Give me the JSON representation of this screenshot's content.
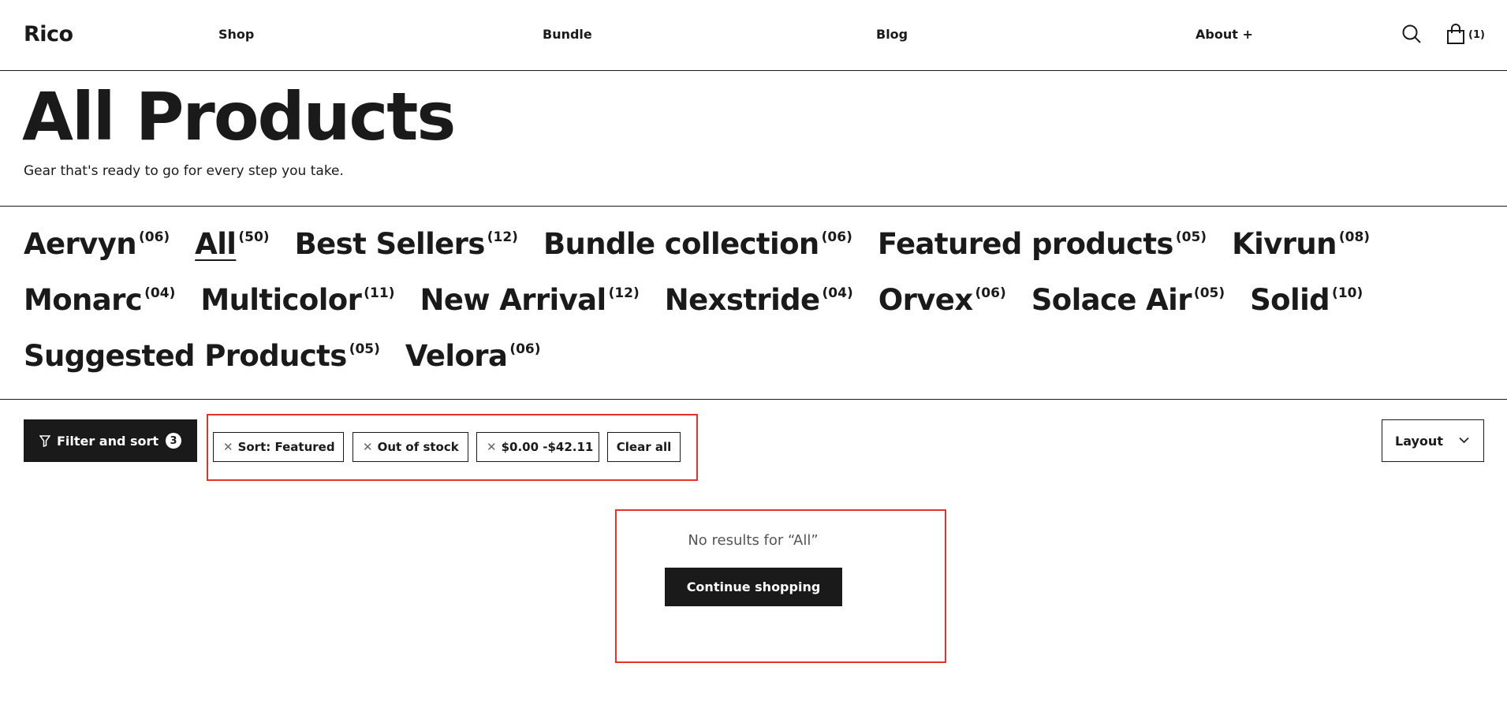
{
  "header": {
    "logo": "Rico",
    "nav": {
      "shop": "Shop",
      "bundle": "Bundle",
      "blog": "Blog",
      "about": "About +"
    },
    "cart_count": "(1)",
    "icons": [
      "search-icon",
      "cart-icon"
    ]
  },
  "page": {
    "title": "All Products",
    "subtitle": "Gear that's ready to go for every step you take."
  },
  "collections": [
    {
      "name": "Aervyn",
      "count": "(06)"
    },
    {
      "name": "All",
      "count": "(50)",
      "active": true
    },
    {
      "name": "Best Sellers",
      "count": "(12)"
    },
    {
      "name": "Bundle collection",
      "count": "(06)"
    },
    {
      "name": "Featured products",
      "count": "(05)"
    },
    {
      "name": "Kivrun",
      "count": "(08)"
    },
    {
      "name": "Monarc",
      "count": "(04)"
    },
    {
      "name": "Multicolor",
      "count": "(11)"
    },
    {
      "name": "New Arrival",
      "count": "(12)"
    },
    {
      "name": "Nexstride",
      "count": "(04)"
    },
    {
      "name": "Orvex",
      "count": "(06)"
    },
    {
      "name": "Solace Air",
      "count": "(05)"
    },
    {
      "name": "Solid",
      "count": "(10)"
    },
    {
      "name": "Suggested Products",
      "count": "(05)"
    },
    {
      "name": "Velora",
      "count": "(06)"
    }
  ],
  "filters": {
    "button_label": "Filter and sort",
    "badge_count": "3",
    "active": {
      "sort": "Sort: Featured",
      "stock": "Out of stock",
      "price": "$0.00 -$42.11"
    },
    "clear_all": "Clear all",
    "layout_label": "Layout"
  },
  "results": {
    "empty_message": "No results for “All”",
    "continue_label": "Continue shopping"
  },
  "colors": {
    "primary": "#1a1a1a",
    "highlight": "#e53228",
    "background": "#ffffff"
  }
}
